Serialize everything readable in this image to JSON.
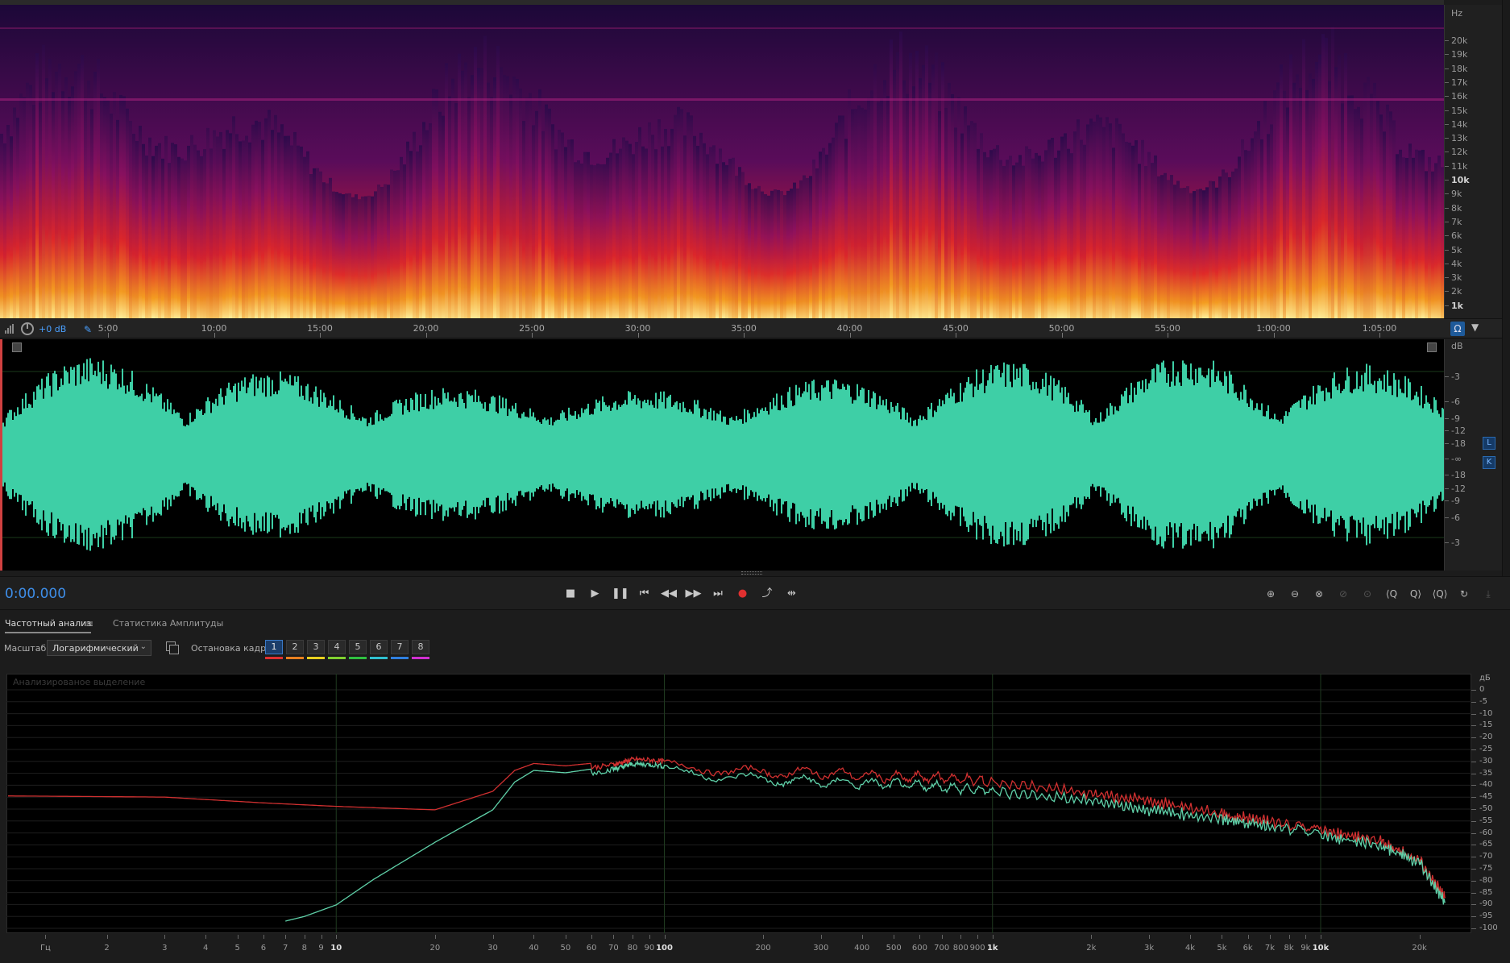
{
  "spectral": {
    "hz_label": "Hz",
    "hz_ticks": [
      "20k",
      "19k",
      "18k",
      "17k",
      "16k",
      "15k",
      "14k",
      "13k",
      "12k",
      "11k",
      "10k",
      "9k",
      "8k",
      "7k",
      "6k",
      "5k",
      "4k",
      "3k",
      "2k",
      "1k"
    ]
  },
  "timeline": {
    "level": "+0 dB",
    "labels": [
      "5:00",
      "10:00",
      "15:00",
      "20:00",
      "25:00",
      "30:00",
      "35:00",
      "40:00",
      "45:00",
      "50:00",
      "55:00",
      "1:00:00",
      "1:05:00"
    ]
  },
  "waveform": {
    "db_label": "dB",
    "db_ticks": [
      "-3",
      "-6",
      "-9",
      "-12",
      "-18",
      "-∞",
      "-18",
      "-12",
      "-9",
      "-6",
      "-3"
    ],
    "channel_left": "L",
    "channel_right": "K",
    "color": "#3ecfa6"
  },
  "transport": {
    "time": "0:00.000",
    "buttons": [
      "■",
      "▶",
      "❚❚",
      "⏮",
      "◀◀",
      "▶▶",
      "⏭",
      "●",
      "⤴",
      "⇹"
    ],
    "zoom_buttons": [
      "⊕",
      "⊖",
      "⊗",
      "⊘",
      "⊙",
      "⟨Q",
      "Q⟩",
      "⟨Q⟩",
      "↻",
      "⤓"
    ]
  },
  "analysis": {
    "tab_active": "Частотный анализ",
    "tab_inactive": "Статистика Амплитуды",
    "scale_label": "Масштаб:",
    "scale_value": "Логарифмический",
    "freeze_label": "Остановка кадра:",
    "frames": [
      "1",
      "2",
      "3",
      "4",
      "5",
      "6",
      "7",
      "8"
    ],
    "frame_colors": [
      "#e03030",
      "#e88020",
      "#e8d020",
      "#80d030",
      "#30c040",
      "#30c0d0",
      "#3080e0",
      "#d030d0"
    ],
    "annotation": "Анализированое выделение",
    "db_label": "дБ",
    "db_ticks": [
      "0",
      "-5",
      "-10",
      "-15",
      "-20",
      "-25",
      "-30",
      "-35",
      "-40",
      "-45",
      "-50",
      "-55",
      "-60",
      "-65",
      "-70",
      "-75",
      "-80",
      "-85",
      "-90",
      "-95",
      "-100"
    ],
    "freq_ticks": [
      {
        "label": "Гц",
        "hz": 1.3,
        "bold": false
      },
      {
        "label": "2",
        "hz": 2,
        "bold": false
      },
      {
        "label": "3",
        "hz": 3,
        "bold": false
      },
      {
        "label": "4",
        "hz": 4,
        "bold": false
      },
      {
        "label": "5",
        "hz": 5,
        "bold": false
      },
      {
        "label": "6",
        "hz": 6,
        "bold": false
      },
      {
        "label": "7",
        "hz": 7,
        "bold": false
      },
      {
        "label": "8",
        "hz": 8,
        "bold": false
      },
      {
        "label": "9",
        "hz": 9,
        "bold": false
      },
      {
        "label": "10",
        "hz": 10,
        "bold": true
      },
      {
        "label": "20",
        "hz": 20,
        "bold": false
      },
      {
        "label": "30",
        "hz": 30,
        "bold": false
      },
      {
        "label": "40",
        "hz": 40,
        "bold": false
      },
      {
        "label": "50",
        "hz": 50,
        "bold": false
      },
      {
        "label": "60",
        "hz": 60,
        "bold": false
      },
      {
        "label": "70",
        "hz": 70,
        "bold": false
      },
      {
        "label": "80",
        "hz": 80,
        "bold": false
      },
      {
        "label": "90",
        "hz": 90,
        "bold": false
      },
      {
        "label": "100",
        "hz": 100,
        "bold": true
      },
      {
        "label": "200",
        "hz": 200,
        "bold": false
      },
      {
        "label": "300",
        "hz": 300,
        "bold": false
      },
      {
        "label": "400",
        "hz": 400,
        "bold": false
      },
      {
        "label": "500",
        "hz": 500,
        "bold": false
      },
      {
        "label": "600",
        "hz": 600,
        "bold": false
      },
      {
        "label": "700",
        "hz": 700,
        "bold": false
      },
      {
        "label": "800",
        "hz": 800,
        "bold": false
      },
      {
        "label": "900",
        "hz": 900,
        "bold": false
      },
      {
        "label": "1k",
        "hz": 1000,
        "bold": true
      },
      {
        "label": "2k",
        "hz": 2000,
        "bold": false
      },
      {
        "label": "3k",
        "hz": 3000,
        "bold": false
      },
      {
        "label": "4k",
        "hz": 4000,
        "bold": false
      },
      {
        "label": "5k",
        "hz": 5000,
        "bold": false
      },
      {
        "label": "6k",
        "hz": 6000,
        "bold": false
      },
      {
        "label": "7k",
        "hz": 7000,
        "bold": false
      },
      {
        "label": "8k",
        "hz": 8000,
        "bold": false
      },
      {
        "label": "9k",
        "hz": 9000,
        "bold": false
      },
      {
        "label": "10k",
        "hz": 10000,
        "bold": true
      },
      {
        "label": "20k",
        "hz": 20000,
        "bold": false
      }
    ]
  },
  "chart_data": {
    "type": "line",
    "x_scale": "log",
    "xlim": [
      1,
      26000
    ],
    "ylim": [
      -100,
      5
    ],
    "series": [
      {
        "color": "#d03030",
        "x": [
          1,
          3,
          6,
          10,
          20,
          30,
          35,
          40,
          50,
          70,
          80,
          100,
          200,
          300,
          500,
          700,
          1000,
          2000,
          3000,
          5000,
          7000,
          10000,
          15000,
          20000,
          24000
        ],
        "values": [
          -46,
          -46.5,
          -49,
          -50.5,
          -52,
          -44,
          -35,
          -32,
          -33,
          -31,
          -30,
          -33,
          -36,
          -36,
          -38,
          -38,
          -40,
          -45,
          -48,
          -54,
          -57,
          -61,
          -65,
          -74,
          -90
        ]
      },
      {
        "color": "#5fd0a8",
        "x": [
          7,
          8,
          10,
          13,
          20,
          30,
          35,
          40,
          50,
          70,
          80,
          100,
          200,
          300,
          500,
          700,
          1000,
          2000,
          3000,
          5000,
          7000,
          10000,
          15000,
          20000,
          24000
        ],
        "values": [
          -100,
          -98,
          -93,
          -82,
          -66,
          -52,
          -40,
          -35,
          -36,
          -33,
          -32,
          -35,
          -39,
          -40,
          -41,
          -42,
          -44,
          -48,
          -52,
          -56,
          -59,
          -63,
          -67,
          -75,
          -92
        ]
      }
    ]
  }
}
